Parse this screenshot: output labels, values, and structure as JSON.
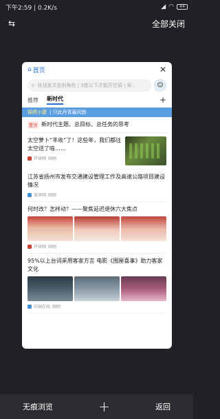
{
  "status": {
    "time_speed": "下午2:59 | 0.2K/s",
    "battery": "44"
  },
  "topbar": {
    "close_all": "全部关闭"
  },
  "card": {
    "home_label": "首页",
    "search_placeholder": "肖战发文告别角色 | 3度以下才能开空调 | 吴...",
    "tabs": [
      "推荐",
      "新时代"
    ],
    "banner_name": "锦绣小康",
    "banner_text": "| 只此丹青最风韵"
  },
  "feed": [
    {
      "type": "top",
      "tag": "置顶",
      "title": "新时代主题、总目标、总任务的思考"
    },
    {
      "type": "thumb",
      "title": "太空萝卜“丰收”了！这些年，我们都往太空送了啥……",
      "source": "环球网",
      "time": "刚刚"
    },
    {
      "type": "text",
      "title": "江苏省扬州市发布交通建设管理工作及高速公路项目建设情况",
      "source": "澎湃网",
      "time": "刚刚"
    },
    {
      "type": "three",
      "title": "何时改？怎样动？——聚焦延迟退休六大焦点",
      "source": "环球网",
      "time": "刚刚"
    },
    {
      "type": "three",
      "title": "95%以上台词采用客家方言 电影《围屋喜事》助力客家文化",
      "source": "中国在线",
      "time": "刚刚"
    }
  ],
  "bottombar": {
    "incognito": "无痕浏览",
    "back": "返回"
  }
}
